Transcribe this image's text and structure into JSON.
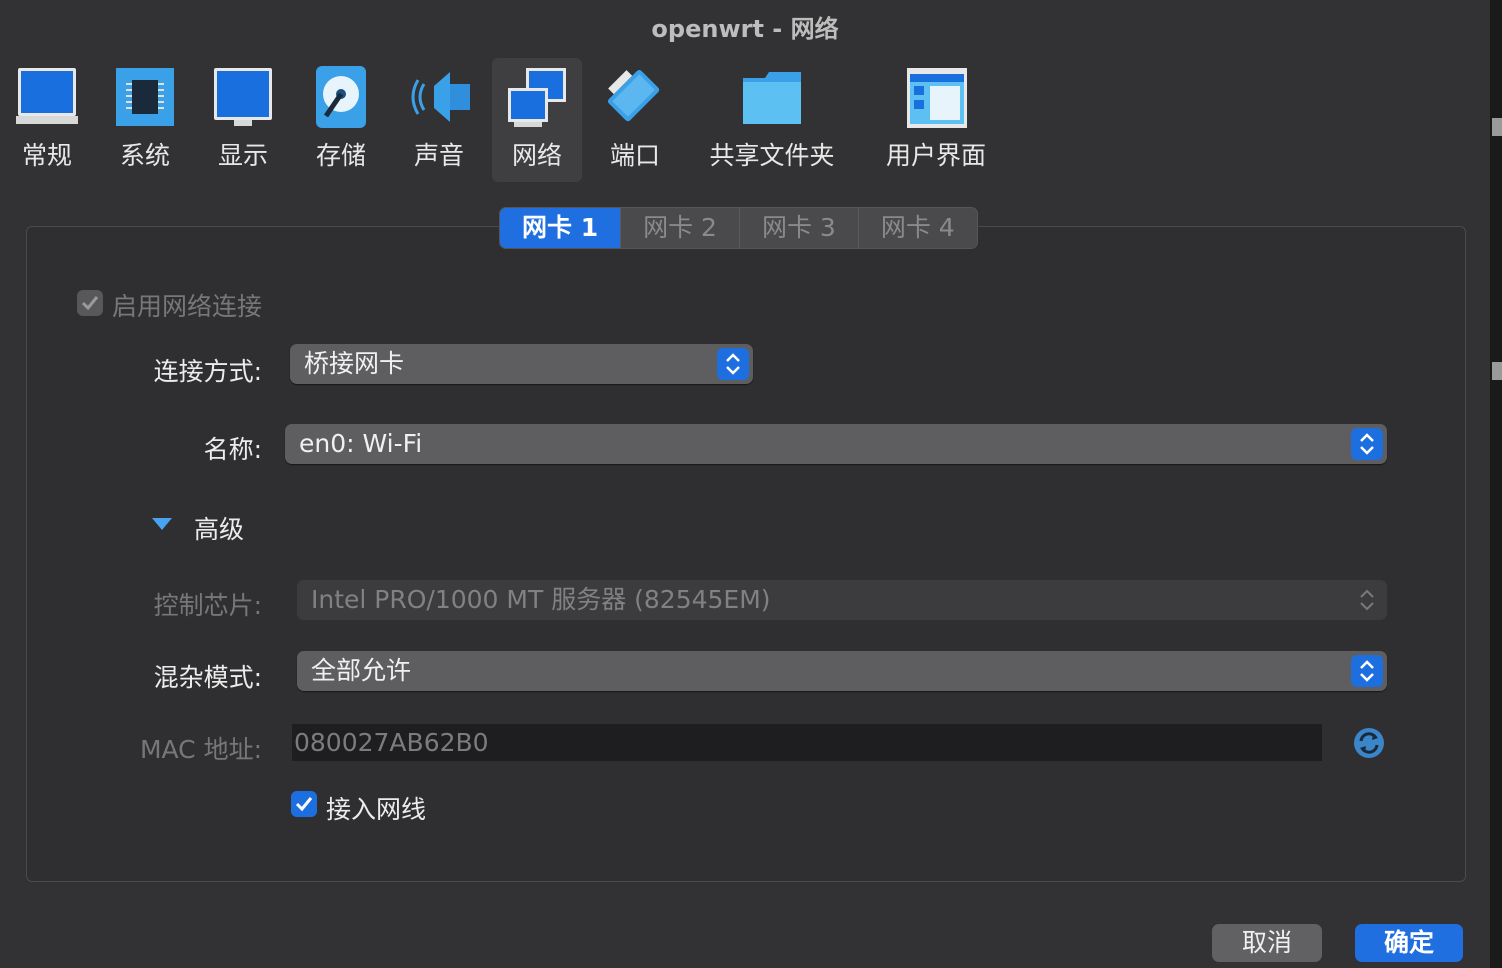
{
  "window": {
    "title": "openwrt - 网络"
  },
  "toolbar": {
    "items": [
      {
        "label": "常规",
        "icon": "general-monitor-icon"
      },
      {
        "label": "系统",
        "icon": "system-chip-icon"
      },
      {
        "label": "显示",
        "icon": "display-monitor-icon"
      },
      {
        "label": "存储",
        "icon": "storage-disk-icon"
      },
      {
        "label": "声音",
        "icon": "speaker-icon"
      },
      {
        "label": "网络",
        "icon": "network-icon",
        "selected": true
      },
      {
        "label": "端口",
        "icon": "serial-port-icon"
      },
      {
        "label": "共享文件夹",
        "icon": "shared-folder-icon"
      },
      {
        "label": "用户界面",
        "icon": "user-interface-icon"
      }
    ]
  },
  "tabs": [
    {
      "label": "网卡 1",
      "active": true
    },
    {
      "label": "网卡 2"
    },
    {
      "label": "网卡 3"
    },
    {
      "label": "网卡 4"
    }
  ],
  "adapter": {
    "enable_label": "启用网络连接",
    "enable_checked": true,
    "attached_to_label": "连接方式:",
    "attached_to_value": "桥接网卡",
    "name_label": "名称:",
    "name_value": "en0: Wi-Fi",
    "advanced_label": "高级",
    "adapter_type_label": "控制芯片:",
    "adapter_type_value": "Intel PRO/1000 MT 服务器 (82545EM)",
    "promiscuous_label": "混杂模式:",
    "promiscuous_value": "全部允许",
    "mac_label": "MAC 地址:",
    "mac_value": "080027AB62B0",
    "cable_label": "接入网线",
    "cable_checked": true
  },
  "buttons": {
    "cancel": "取消",
    "ok": "确定"
  },
  "colors": {
    "accent": "#1f6fe0",
    "background": "#323234"
  }
}
